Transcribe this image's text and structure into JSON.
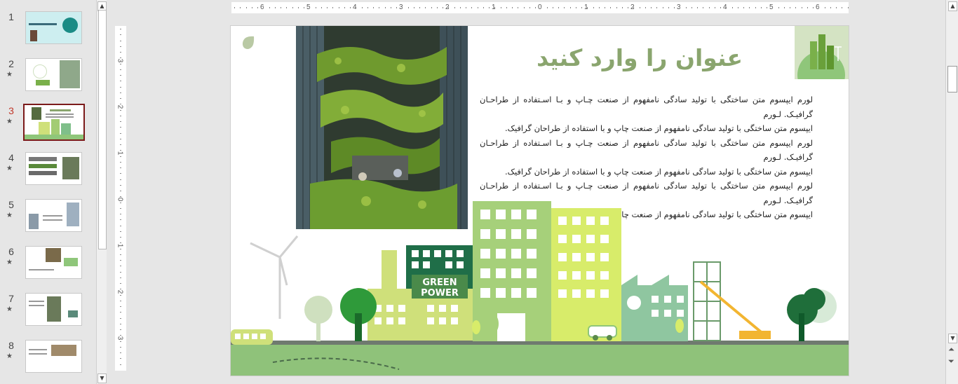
{
  "slides_pane": {
    "items": [
      {
        "number": "1",
        "star": "",
        "active": false
      },
      {
        "number": "2",
        "star": "★",
        "active": false
      },
      {
        "number": "3",
        "star": "★",
        "active": true
      },
      {
        "number": "4",
        "star": "★",
        "active": false
      },
      {
        "number": "5",
        "star": "★",
        "active": false
      },
      {
        "number": "6",
        "star": "★",
        "active": false
      },
      {
        "number": "7",
        "star": "★",
        "active": false
      },
      {
        "number": "8",
        "star": "★",
        "active": false
      }
    ]
  },
  "ruler": {
    "horizontal_labels": [
      "6",
      "5",
      "4",
      "3",
      "2",
      "1",
      "0",
      "1",
      "2",
      "3",
      "4",
      "5",
      "6"
    ],
    "vertical_labels": [
      "3",
      "2",
      "1",
      "0",
      "1",
      "2",
      "3"
    ]
  },
  "slide": {
    "title": "عنوان را وارد کنید",
    "body_lines": [
      "لورم ایپسوم متن ساختگی با تولید سادگی نامفهوم از صنعت چـاپ و بـا اسـتفاده از طراحـان گرافیـک. لـورم",
      "ایپسوم متن ساختگی با تولید سادگی نامفهوم از صنعت چاپ و با استفاده از طراحان گرافیک.",
      "لورم ایپسوم متن ساختگی با تولید سادگی نامفهوم از صنعت چـاپ و بـا اسـتفاده از طراحـان گرافیـک. لـورم",
      "ایپسوم متن ساختگی با تولید سادگی نامفهوم از صنعت چاپ و با استفاده از طراحان گرافیک.",
      "لورم ایپسوم متن ساختگی با تولید سادگی نامفهوم از صنعت چـاپ و بـا اسـتفاده از طراحـان گرافیـک. لـورم",
      "ایپسوم متن ساختگی با تولید سادگی نامفهوم از صنعت چاپ و با استفاده از طراحان گرافیک."
    ],
    "sign_line1": "GREEN",
    "sign_line2": "POWER"
  },
  "colors": {
    "title_green": "#8aa56e",
    "active_thumb_border": "#7b1a1a",
    "active_number": "#c0392b"
  }
}
